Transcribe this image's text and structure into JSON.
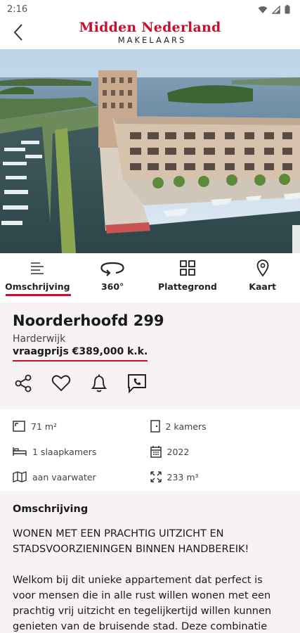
{
  "status_bar": {
    "time": "2:16"
  },
  "header": {
    "logo_line1": "Midden Nederland",
    "logo_line2": "MAKELAARS"
  },
  "tabs": [
    {
      "label": "Omschrijving",
      "icon": "text-lines-icon",
      "active": true
    },
    {
      "label": "360°",
      "icon": "rotate-360-icon",
      "active": false
    },
    {
      "label": "Plattegrond",
      "icon": "floorplan-icon",
      "active": false
    },
    {
      "label": "Kaart",
      "icon": "map-pin-icon",
      "active": false
    }
  ],
  "listing": {
    "title": "Noorderhoofd 299",
    "city": "Harderwijk",
    "price": "vraagprijs €389,000 k.k."
  },
  "actions": [
    "share-icon",
    "heart-icon",
    "bell-icon",
    "chat-phone-icon"
  ],
  "features": {
    "area": "71 m²",
    "rooms": "2 kamers",
    "bedrooms": "1 slaapkamers",
    "year": "2022",
    "location": "aan vaarwater",
    "volume": "233 m³"
  },
  "description": {
    "heading": "Omschrijving",
    "intro": "WONEN MET EEN PRACHTIG UITZICHT EN STADSVOORZIENINGEN BINNEN HANDBEREIK!",
    "body": "Welkom bij dit unieke appartement dat perfect is voor mensen die in alle rust willen wonen met een prachtig vrij uitzicht en tegelijkertijd willen kunnen genieten van de bruisende stad. Deze combinatie"
  },
  "colors": {
    "accent": "#c8102e",
    "panel": "#f7f3f3"
  }
}
